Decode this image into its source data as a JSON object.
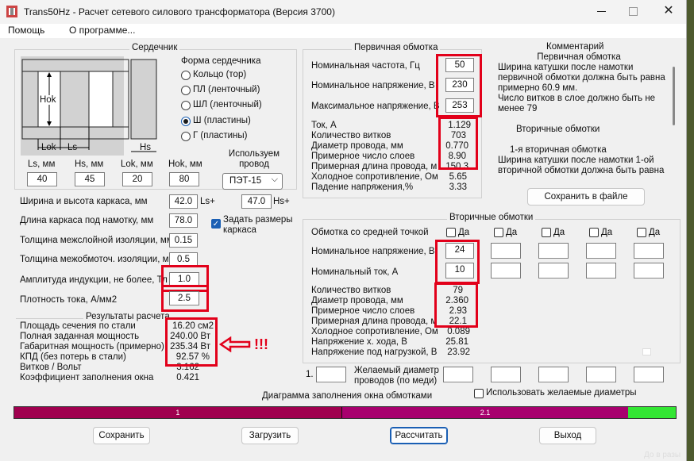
{
  "window": {
    "title": "Trans50Hz - Расчет сетевого силового трансформатора (Версия 3700)",
    "app_icon": "transformer-icon",
    "controls": [
      "minimize-icon",
      "maximize-icon",
      "close-icon"
    ]
  },
  "menu": {
    "help": "Помощь",
    "about": "О программе..."
  },
  "core": {
    "title": "Сердечник",
    "diagram": {
      "hok": "Hok",
      "lok": "Lok",
      "ls": "Ls",
      "hs": "Hs"
    },
    "shape_title": "Форма сердечника",
    "shapes": [
      {
        "label": "Кольцо   (тор)",
        "selected": false
      },
      {
        "label": "ПЛ  (ленточный)",
        "selected": false
      },
      {
        "label": "ШЛ  (ленточный)",
        "selected": false
      },
      {
        "label": "Ш  (пластины)",
        "selected": true
      },
      {
        "label": "Г  (пластины)",
        "selected": false
      }
    ],
    "dims": [
      {
        "label": "Ls, мм",
        "value": "40"
      },
      {
        "label": "Hs, мм",
        "value": "45"
      },
      {
        "label": "Lok, мм",
        "value": "20"
      },
      {
        "label": "Hok, мм",
        "value": "80"
      }
    ],
    "wire_title": "Используем провод",
    "wire_select": "ПЭТ-15"
  },
  "params": {
    "frame_wh_label": "Ширина и высота каркаса, мм",
    "frame_w": "42.0",
    "ls_plus": "Ls+",
    "frame_h": "47.0",
    "hs_plus": "Hs+",
    "frame_len_label": "Длина каркаса под намотку, мм",
    "frame_len": "78.0",
    "set_frame_label": "Задать размеры каркаса",
    "set_frame_checked": true,
    "interlayer_label": "Толщина межслойной изоляции, мм",
    "interlayer": "0.15",
    "interwinding_label": "Толщина межобмоточ. изоляции, мм",
    "interwinding": "0.5",
    "induction_label": "Амплитуда индукции, не более, Тл",
    "induction": "1.0",
    "current_density_label": "Плотность тока, А/мм2",
    "current_density": "2.5"
  },
  "results": {
    "title": "Результаты расчета",
    "rows": [
      {
        "label": "Площадь сечения по стали",
        "value": "16.20 см2"
      },
      {
        "label": "Полная заданная мощность",
        "value": "240.00 Вт"
      },
      {
        "label": "Габаритная мощность (примерно)",
        "value": "235.34 Вт"
      },
      {
        "label": "КПД (без потерь в стали)",
        "value": "92.57 %"
      },
      {
        "label": "Витков / Вольт",
        "value": "3.162"
      },
      {
        "label": "Коэффициент заполнения окна",
        "value": "0.421"
      }
    ],
    "annotation": "!!!"
  },
  "primary": {
    "title": "Первичная обмотка",
    "freq_label": "Номинальная частота, Гц",
    "freq": "50",
    "volt_label": "Номинальное напряжение, В",
    "volt": "230",
    "vmax_label": "Максимальное напряжение, В",
    "vmax": "253",
    "rows": [
      {
        "label": "Ток, А",
        "value": "1.129"
      },
      {
        "label": "Количество витков",
        "value": "703"
      },
      {
        "label": "Диаметр провода, мм",
        "value": "0.770"
      },
      {
        "label": "Примерное число слоев",
        "value": "8.90"
      },
      {
        "label": "Примерная длина провода, м",
        "value": "150.3"
      },
      {
        "label": "Холодное сопротивление, Ом",
        "value": "5.65"
      },
      {
        "label": "Падение напряжения,%",
        "value": "3.33"
      }
    ]
  },
  "comment": {
    "title": "Комментарий",
    "lines": [
      "Первичная обмотка",
      "Ширина катушки после намотки",
      "первичной обмотки должна быть равна",
      "примерно 60.9 мм.",
      "Число витков в слое должно быть не",
      "менее 79",
      "",
      "Вторичные обмотки",
      "",
      "1-я вторичная обмотка",
      "Ширина катушки после намотки 1-ой",
      "вторичной обмотки должна быть равна"
    ],
    "save_button": "Сохранить в файле"
  },
  "secondary": {
    "title": "Вторичные обмотки",
    "center_tap_label": "Обмотка со средней точкой",
    "da": "Да",
    "volt_label": "Номинальное напряжение, В",
    "volt": "24",
    "curr_label": "Номинальный ток, А",
    "curr": "10",
    "rows": [
      {
        "label": "Количество витков",
        "value": "79"
      },
      {
        "label": "Диаметр провода, мм",
        "value": "2.360"
      },
      {
        "label": "Примерное число слоев",
        "value": "2.93"
      },
      {
        "label": "Примерная длина провода, м",
        "value": "22.1"
      },
      {
        "label": "Холодное сопротивление, Ом",
        "value": "0.089"
      },
      {
        "label": "Напряжение х. хода, В",
        "value": "25.81"
      },
      {
        "label": "Напряжение под нагрузкой, В",
        "value": "23.92"
      }
    ],
    "desired_index": "1.",
    "desired_label": "Желаемый диаметр проводов  (по меди)",
    "use_desired_label": "Использовать желаемые диаметры"
  },
  "fill_diagram": {
    "title": "Диаграмма заполнения окна обмотками",
    "segments": [
      {
        "label": "1",
        "fraction": 0.475,
        "color": "#a0004f"
      },
      {
        "label": "2.1",
        "fraction": 0.4,
        "color": "#a8006e"
      },
      {
        "label": "",
        "fraction": 0.073,
        "color": "#33e633"
      }
    ]
  },
  "buttons": {
    "save": "Сохранить",
    "load": "Загрузить",
    "calc": "Рассчитать",
    "exit": "Выход"
  },
  "taskbar_hint": "До в разы"
}
